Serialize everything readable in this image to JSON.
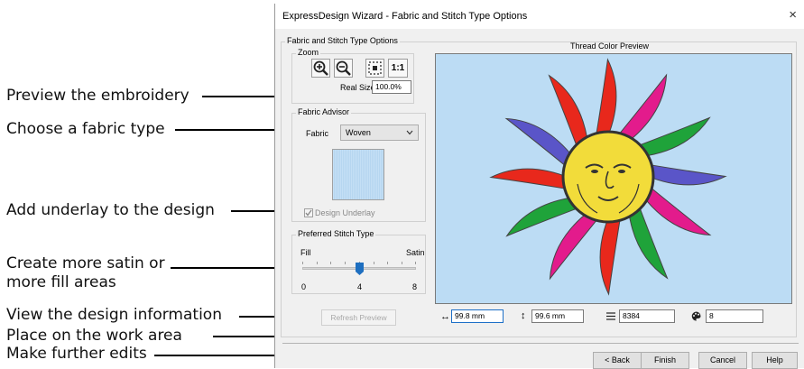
{
  "callouts": [
    "Preview the embroidery",
    "Choose a fabric type",
    "Add underlay to the design",
    "Create more satin or",
    "more fill areas",
    "View the design information",
    "Place on the work area",
    "Make further edits"
  ],
  "dialog": {
    "title": "ExpressDesign Wizard - Fabric and Stitch Type Options",
    "close_glyph": "×",
    "section_title": "Fabric and Stitch Type Options",
    "zoom": {
      "label": "Zoom",
      "fit_label": "1:1",
      "real_size_label": "Real Size",
      "real_size_value": "100.0%"
    },
    "fabric_advisor": {
      "label": "Fabric Advisor",
      "fabric_label": "Fabric",
      "fabric_value": "Woven",
      "underlay_label": "Design Underlay",
      "underlay_checked": true
    },
    "stitch_type": {
      "label": "Preferred Stitch Type",
      "fill_label": "Fill",
      "satin_label": "Satin",
      "min": "0",
      "mid": "4",
      "max": "8",
      "value": 4
    },
    "refresh_label": "Refresh Preview",
    "preview_title": "Thread Color Preview",
    "info": {
      "width": "99.8 mm",
      "height": "99.6 mm",
      "stitches": "8384",
      "colors": "8"
    },
    "buttons": {
      "back": "< Back",
      "finish": "Finish",
      "cancel": "Cancel",
      "help": "Help"
    }
  },
  "colors": {
    "preview_bg": "#bcdcf4",
    "slider_thumb": "#1e6fc0",
    "sun_face": "#f2dc3a",
    "ray_red": "#e8281c",
    "ray_green": "#1fa33a",
    "ray_magenta": "#e31b8c",
    "ray_blue": "#5a55c8"
  }
}
